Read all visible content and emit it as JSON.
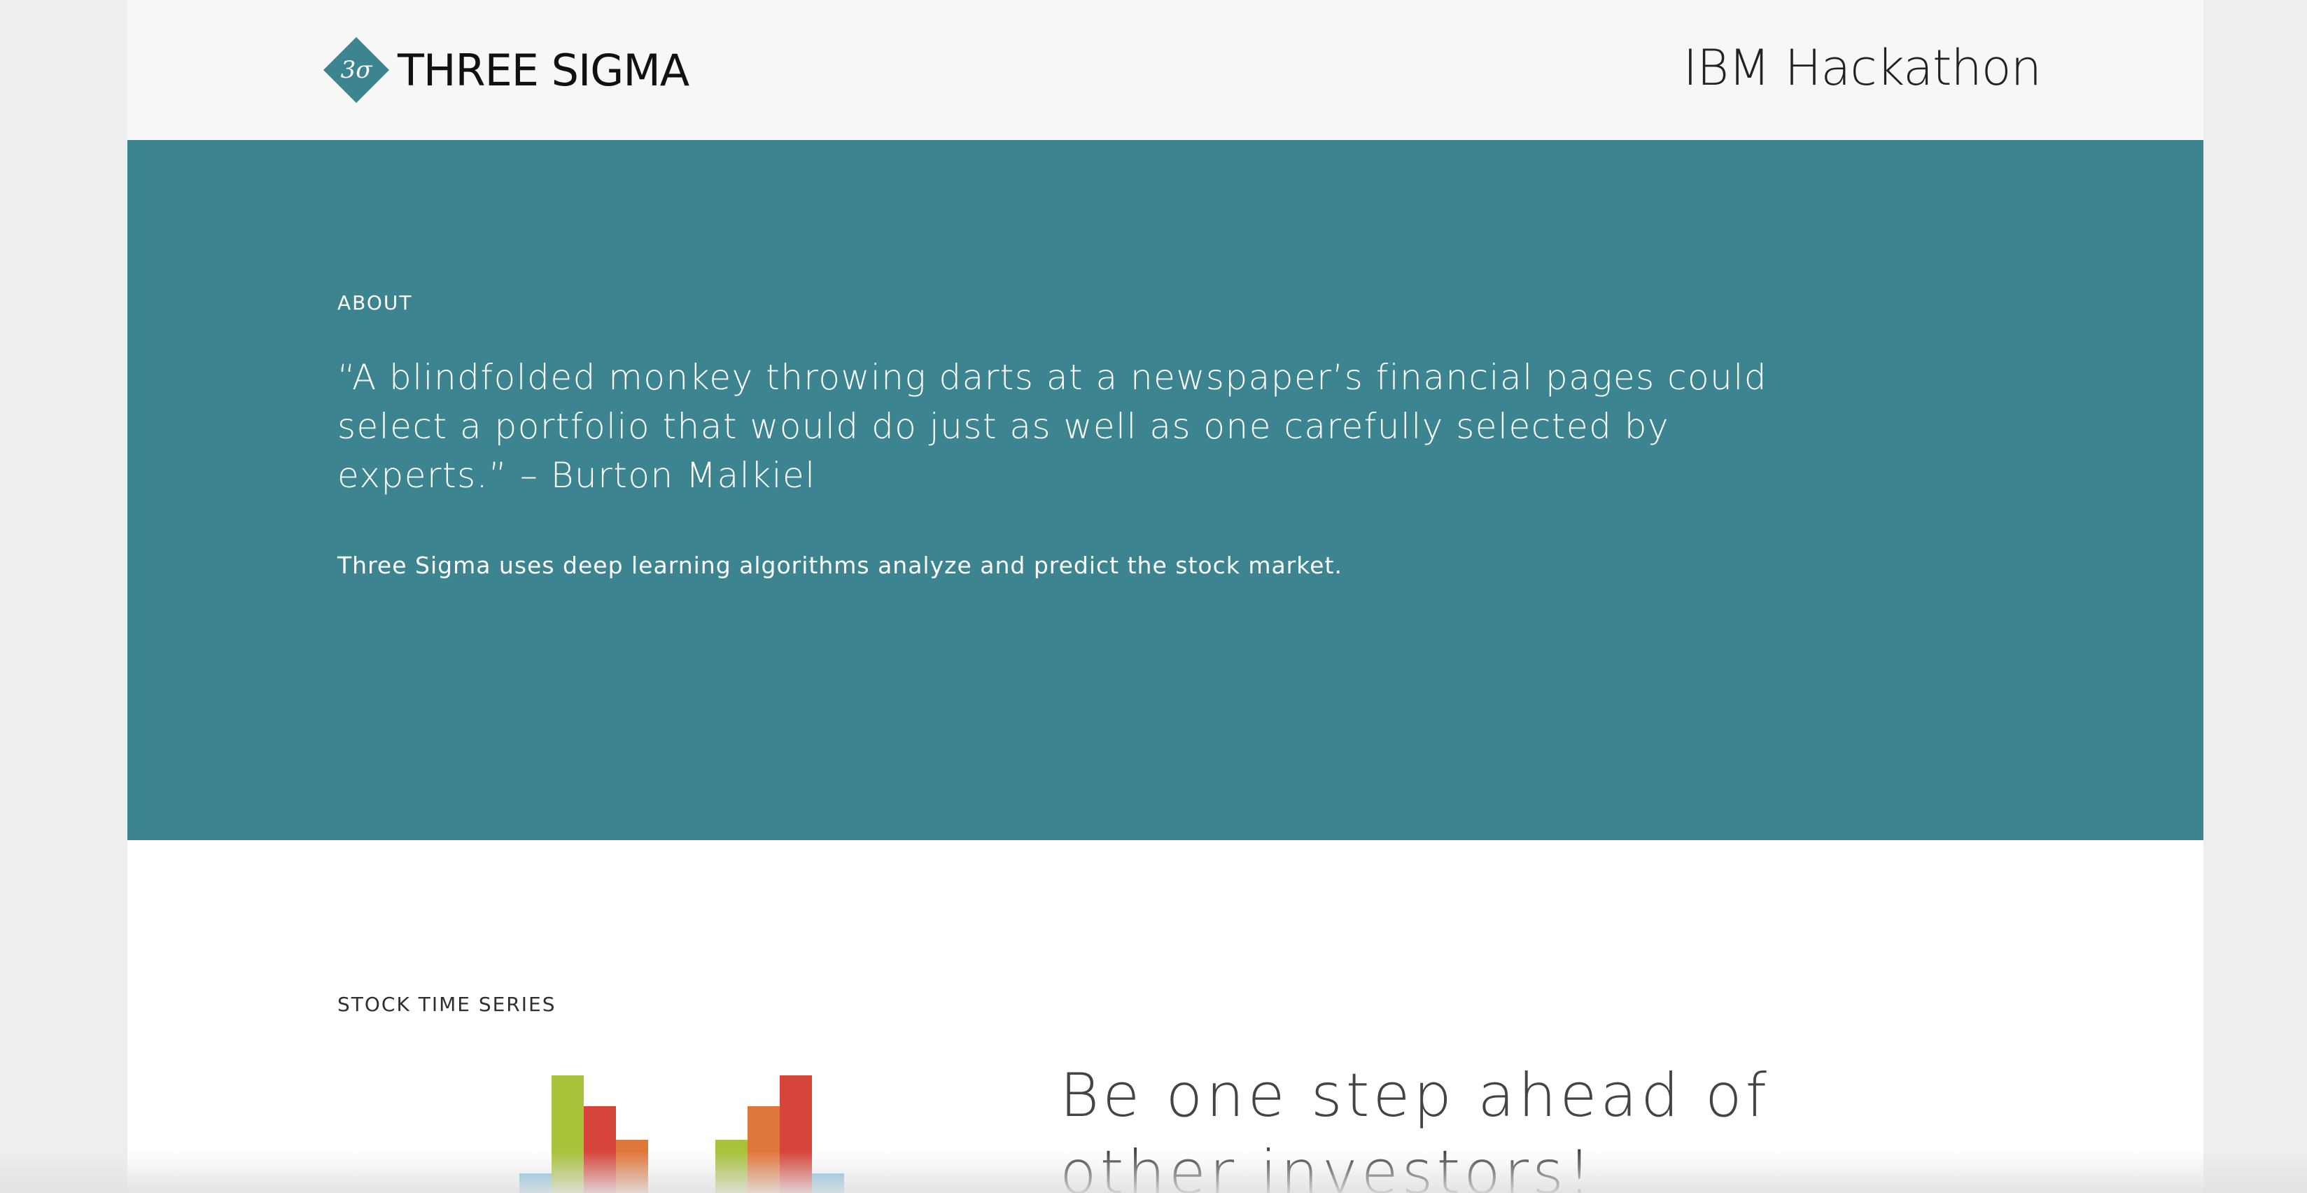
{
  "header": {
    "brand_name": "THREE SIGMA",
    "logo_text": "3σ",
    "logo_icon": "diamond-logo-icon",
    "event_title": "IBM Hackathon"
  },
  "about": {
    "label": "ABOUT",
    "quote": "“A blindfolded monkey throwing darts at a newspaper’s financial pages could select a portfolio that would do just as well as one carefully selected by experts.” – Burton Malkiel",
    "description": "Three Sigma uses deep learning algorithms analyze and predict the stock market."
  },
  "stock_time_series": {
    "label": "STOCK TIME SERIES",
    "headline": "Be one step ahead of other investors!"
  },
  "colors": {
    "teal": "#3b8490",
    "topbar_bg": "#f7f7f7",
    "bar_blue": "#6cb8e0",
    "bar_green": "#a8c23a",
    "bar_red": "#d6443a",
    "bar_orange": "#e0773a"
  }
}
